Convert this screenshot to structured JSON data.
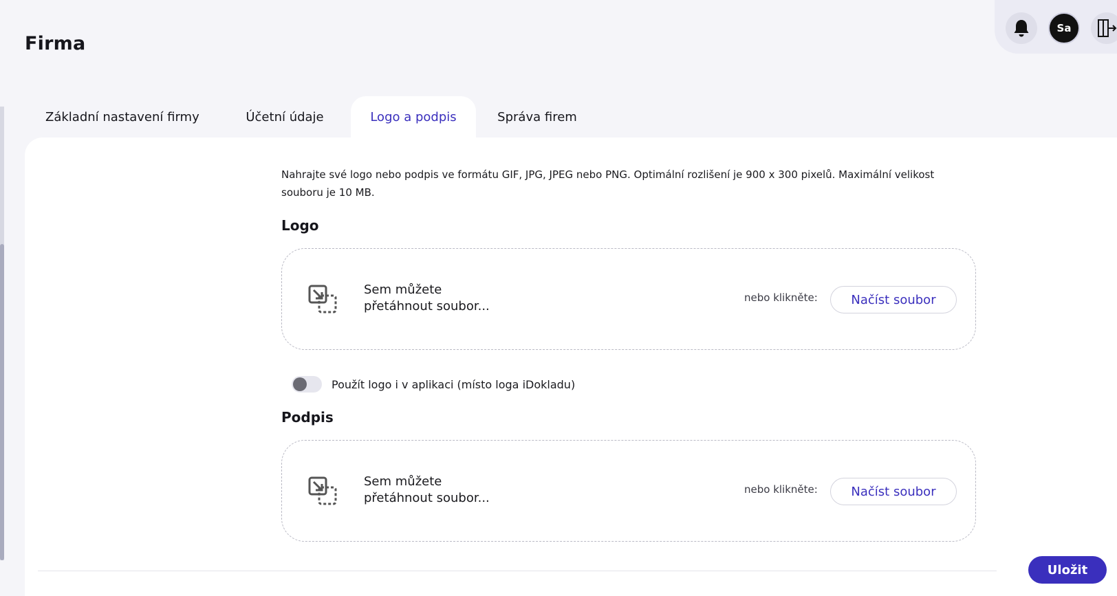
{
  "page": {
    "title": "Firma"
  },
  "header": {
    "notifications_icon": "bell-icon",
    "avatar_initials": "Sa",
    "logout_icon": "logout-door-icon"
  },
  "tabs": [
    {
      "label": "Základní nastavení firmy",
      "active": false
    },
    {
      "label": "Účetní údaje",
      "active": false
    },
    {
      "label": "Logo a podpis",
      "active": true
    },
    {
      "label": "Správa firem",
      "active": false
    }
  ],
  "content": {
    "description": "Nahrajte své logo nebo podpis ve formátu GIF, JPG, JPEG nebo PNG. Optimální rozlišení je 900 x 300 pixelů. Maximální velikost souboru je 10 MB.",
    "logo": {
      "heading": "Logo",
      "dropzone_line1": "Sem můžete",
      "dropzone_line2": "přetáhnout soubor...",
      "or_click": "nebo klikněte:",
      "upload_button": "Načíst soubor"
    },
    "toggle": {
      "label": "Použít logo i v aplikaci (místo loga iDokladu)",
      "checked": false
    },
    "signature": {
      "heading": "Podpis",
      "dropzone_line1": "Sem můžete",
      "dropzone_line2": "přetáhnout soubor...",
      "or_click": "nebo klikněte:",
      "upload_button": "Načíst soubor"
    }
  },
  "footer": {
    "save_label": "Uložit"
  },
  "colors": {
    "accent": "#3a2fbd",
    "background": "#f5f5f9",
    "card": "#ffffff"
  }
}
